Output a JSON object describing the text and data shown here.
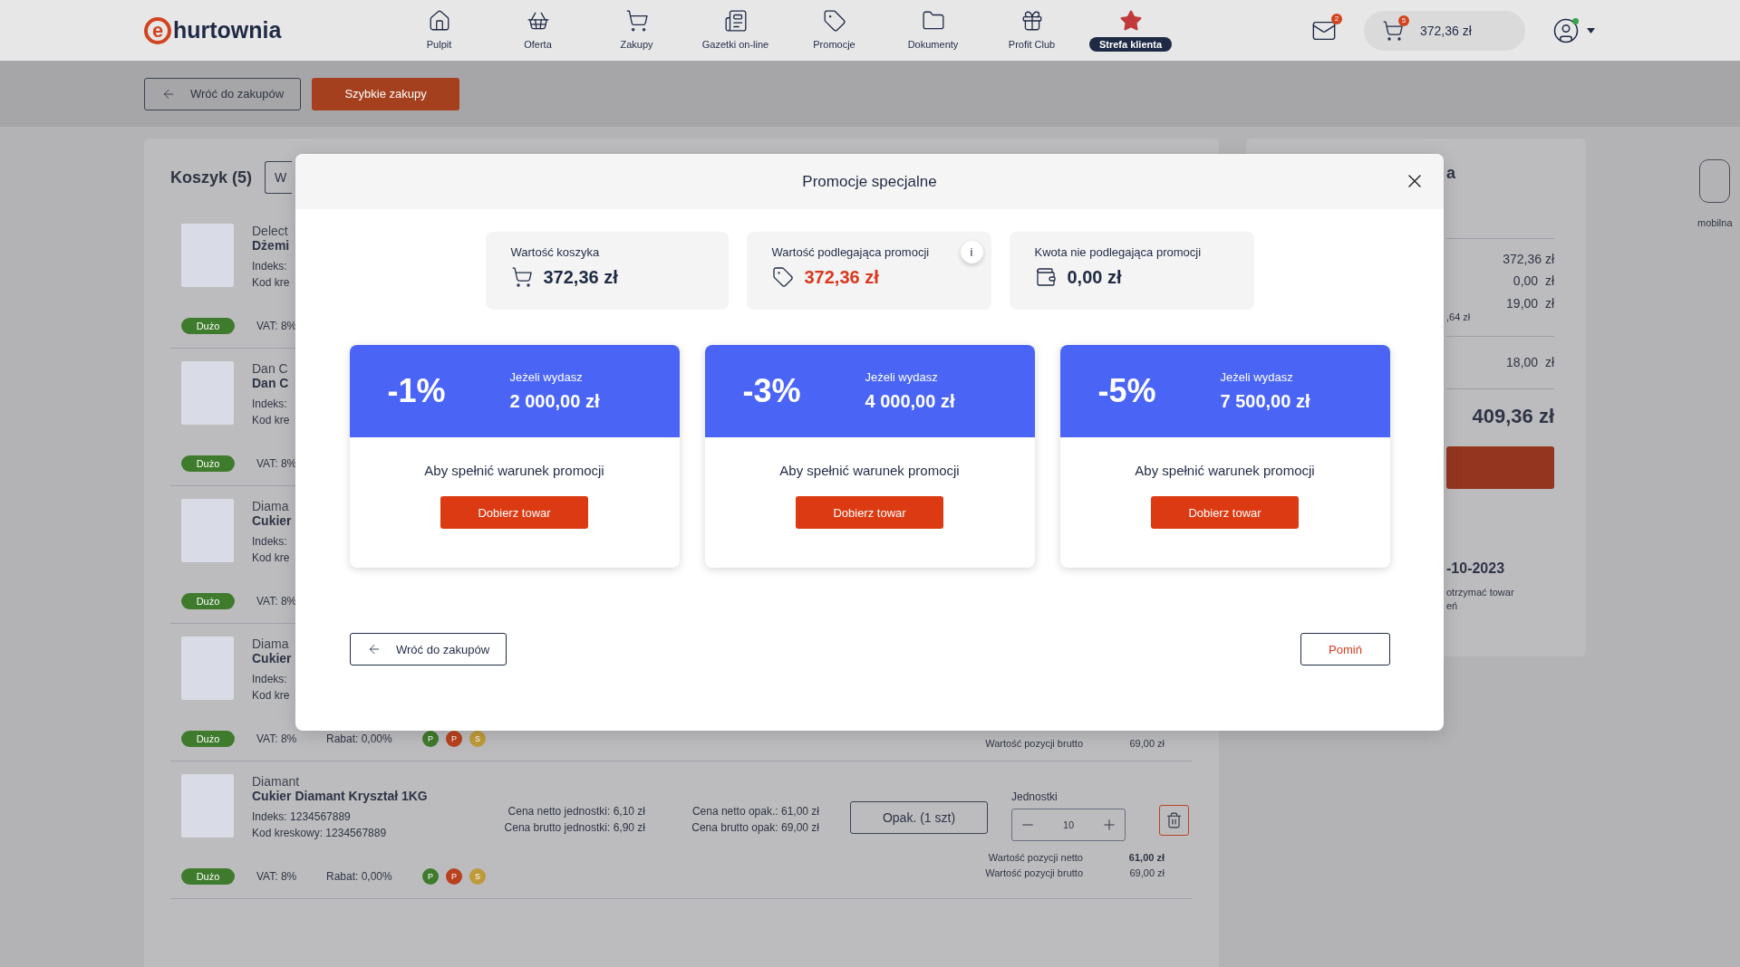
{
  "header": {
    "logo_letter": "e",
    "logo_text": "hurtownia",
    "nav": [
      {
        "label": "Pulpit",
        "selected": false
      },
      {
        "label": "Oferta",
        "selected": false
      },
      {
        "label": "Zakupy",
        "selected": false
      },
      {
        "label": "Gazetki on-line",
        "selected": false
      },
      {
        "label": "Promocje",
        "selected": false
      },
      {
        "label": "Dokumenty",
        "selected": false
      },
      {
        "label": "Profit Club",
        "selected": false
      },
      {
        "label": "Strefa klienta",
        "selected": true
      }
    ],
    "messages_badge": "2",
    "cart_badge": "5",
    "cart_total": "372,36 zł"
  },
  "toolbar": {
    "back": "Wróć do zakupów",
    "quick": "Szybkie zakupy"
  },
  "cart": {
    "title": "Koszyk (5)",
    "tab_fragment": "W",
    "items": [
      {
        "brand": "Delect",
        "name": "Dżemi",
        "index": "Indeks:",
        "code": "Kod kre",
        "stock": "Dużo",
        "vat": "VAT: 8%"
      },
      {
        "brand": "Dan C",
        "name": "Dan C",
        "index": "Indeks:",
        "code": "Kod kre",
        "stock": "Dużo",
        "vat": "VAT: 8%"
      },
      {
        "brand": "Diama",
        "name": "Cukier",
        "index": "Indeks:",
        "code": "Kod kre",
        "stock": "Dużo",
        "vat": "VAT: 8%"
      },
      {
        "brand": "Diama",
        "name": "Cukier",
        "index": "Indeks:",
        "code": "Kod kre",
        "stock": "Dużo",
        "vat": "VAT: 8%",
        "discount": "Rabat: 0,00%",
        "tags": [
          {
            "label": "P",
            "color": "#3f7b2d"
          },
          {
            "label": "P",
            "color": "#b8421f"
          },
          {
            "label": "S",
            "color": "#bf9a3a"
          }
        ],
        "totals": [
          {
            "label": "Wartość pozycji brutto",
            "value": "69,00 zł"
          }
        ]
      },
      {
        "brand": "Diamant",
        "name": "Cukier Diamant Kryształ  1KG",
        "index": "Indeks:",
        "index_value": "1234567889",
        "code": "Kod kreskowy:",
        "code_value": "1234567889",
        "stock": "Dużo",
        "vat": "VAT: 8%",
        "discount": "Rabat: 0,00%",
        "tags": [
          {
            "label": "P",
            "color": "#3f7b2d"
          },
          {
            "label": "P",
            "color": "#b8421f"
          },
          {
            "label": "S",
            "color": "#bf9a3a"
          }
        ],
        "prices": [
          [
            {
              "label": "Cena netto jednostki:",
              "value": "6,10 zł"
            },
            {
              "label": "Cena brutto jednostki:",
              "value": "6,90 zł"
            }
          ],
          [
            {
              "label": "Cena netto opak.:",
              "value": "61,00 zł"
            },
            {
              "label": "Cena brutto opak:",
              "value": "69,00 zł"
            }
          ]
        ],
        "package": "Opak. (1 szt)",
        "units_label": "Jednostki",
        "quantity": "10",
        "totals": [
          {
            "label": "Wartość pozycji netto",
            "value": "61,00 zł"
          },
          {
            "label": "Wartość pozycji brutto",
            "value": "69,00 zł"
          }
        ]
      }
    ]
  },
  "summary": {
    "heading_fragment": "a",
    "values": [
      "372,36 zł",
      "0,00  zł",
      "19,00  zł"
    ],
    "note_fragment": ",64 zł",
    "shipping": "18,00  zł",
    "total": "409,36 zł",
    "date_fragment": "-10-2023",
    "info_fragments": [
      "otrzymać towar",
      "eń"
    ]
  },
  "mobile": {
    "label": "mobilna"
  },
  "modal": {
    "title": "Promocje specjalne",
    "stats": [
      {
        "label": "Wartość koszyka",
        "value": "372,36 zł",
        "highlight": false
      },
      {
        "label": "Wartość podlegająca promocji",
        "value": "372,36 zł",
        "highlight": true,
        "info": "i"
      },
      {
        "label": "Kwota nie podlegająca promocji",
        "value": "0,00 zł",
        "highlight": false
      }
    ],
    "promos": [
      {
        "discount": "-1%",
        "condition": "Jeżeli wydasz",
        "threshold": "2 000,00 zł",
        "text": "Aby spełnić warunek promocji",
        "button": "Dobierz towar"
      },
      {
        "discount": "-3%",
        "condition": "Jeżeli wydasz",
        "threshold": "4 000,00 zł",
        "text": "Aby spełnić warunek promocji",
        "button": "Dobierz towar"
      },
      {
        "discount": "-5%",
        "condition": "Jeżeli wydasz",
        "threshold": "7 500,00 zł",
        "text": "Aby spełnić warunek promocji",
        "button": "Dobierz towar"
      }
    ],
    "back": "Wróć do zakupów",
    "skip": "Pomiń"
  }
}
